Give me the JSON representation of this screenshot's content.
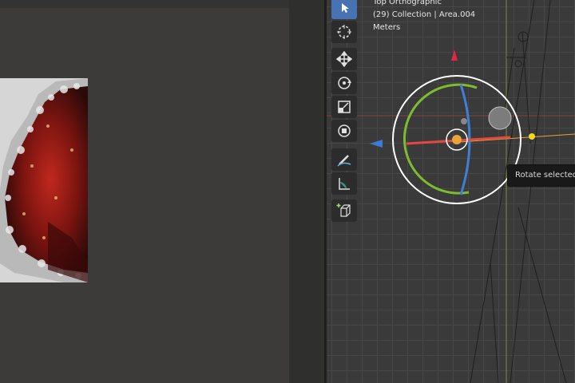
{
  "viewport": {
    "view_name": "Top Orthographic",
    "collection_info": "(29) Collection | Area.004",
    "units": "Meters",
    "tooltip": "Rotate selected items"
  },
  "toolbar": {
    "tools": [
      {
        "icon": "select-cursor-icon",
        "active": true
      },
      {
        "icon": "cursor-icon",
        "active": false
      },
      {
        "icon": "move-icon",
        "active": false
      },
      {
        "icon": "rotate-icon",
        "active": false
      },
      {
        "icon": "scale-icon",
        "active": false
      },
      {
        "icon": "transform-icon",
        "active": false
      },
      {
        "icon": "annotate-icon",
        "active": false
      },
      {
        "icon": "measure-icon",
        "active": false
      },
      {
        "icon": "add-cube-icon",
        "active": false
      }
    ]
  },
  "colors": {
    "gizmo_x": "#e04a3f",
    "gizmo_y": "#7cbd2f",
    "gizmo_z": "#3f7fd6",
    "gizmo_view": "#ffffff",
    "selection": "#e8a33a",
    "active_tool": "#4772b3"
  }
}
